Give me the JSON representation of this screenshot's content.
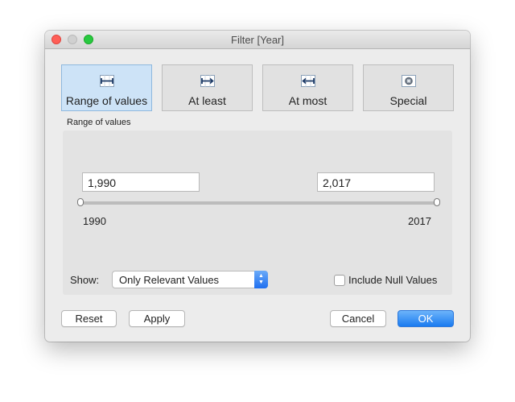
{
  "window": {
    "title": "Filter [Year]"
  },
  "modes": [
    {
      "label": "Range of values",
      "icon": "range-icon",
      "selected": true
    },
    {
      "label": "At least",
      "icon": "at-least-icon",
      "selected": false
    },
    {
      "label": "At most",
      "icon": "at-most-icon",
      "selected": false
    },
    {
      "label": "Special",
      "icon": "special-icon",
      "selected": false
    }
  ],
  "range": {
    "section_label": "Range of values",
    "from_value": "1,990",
    "to_value": "2,017",
    "min_label": "1990",
    "max_label": "2017",
    "selected_from_fraction": 0.0,
    "selected_to_fraction": 1.0
  },
  "show": {
    "label": "Show:",
    "selected": "Only Relevant Values"
  },
  "include_null": {
    "label": "Include Null Values",
    "checked": false
  },
  "buttons": {
    "reset": "Reset",
    "apply": "Apply",
    "cancel": "Cancel",
    "ok": "OK"
  },
  "colors": {
    "selected_mode": "#cde3f7",
    "accent": "#1a7bf0"
  }
}
